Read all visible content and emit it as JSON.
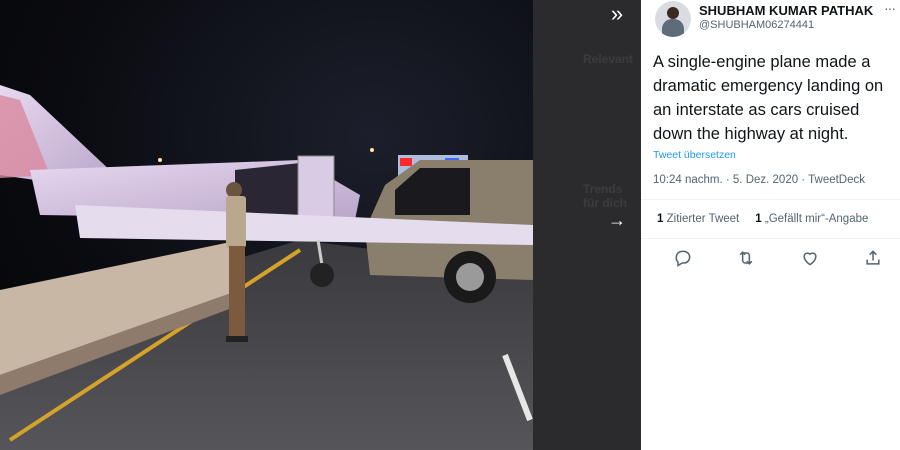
{
  "viewer": {
    "expand_icon": "double-chevron-right-icon",
    "next_icon": "arrow-right-icon",
    "photo_alt": "Plane crashed on highway at night"
  },
  "backdrop": {
    "ghost_labels": [
      "Relevant",
      "Trends für dich"
    ]
  },
  "tweet": {
    "display_name": "SHUBHAM KUMAR PATHAK ...",
    "handle": "@SHUBHAM06274441",
    "text": "A single-engine plane made a dramatic emergency landing on an interstate as cars cruised down the highway at night.",
    "translate": "Tweet übersetzen",
    "meta": "10:24 nachm. · 5. Dez. 2020 · TweetDeck",
    "quote_count": "1",
    "quote_label": "Zitierter Tweet",
    "like_count": "1",
    "like_label": "„Gefällt mir“-Angabe"
  },
  "colors": {
    "link": "#1d9bf0",
    "text": "#0f1419",
    "muted": "#536471"
  }
}
